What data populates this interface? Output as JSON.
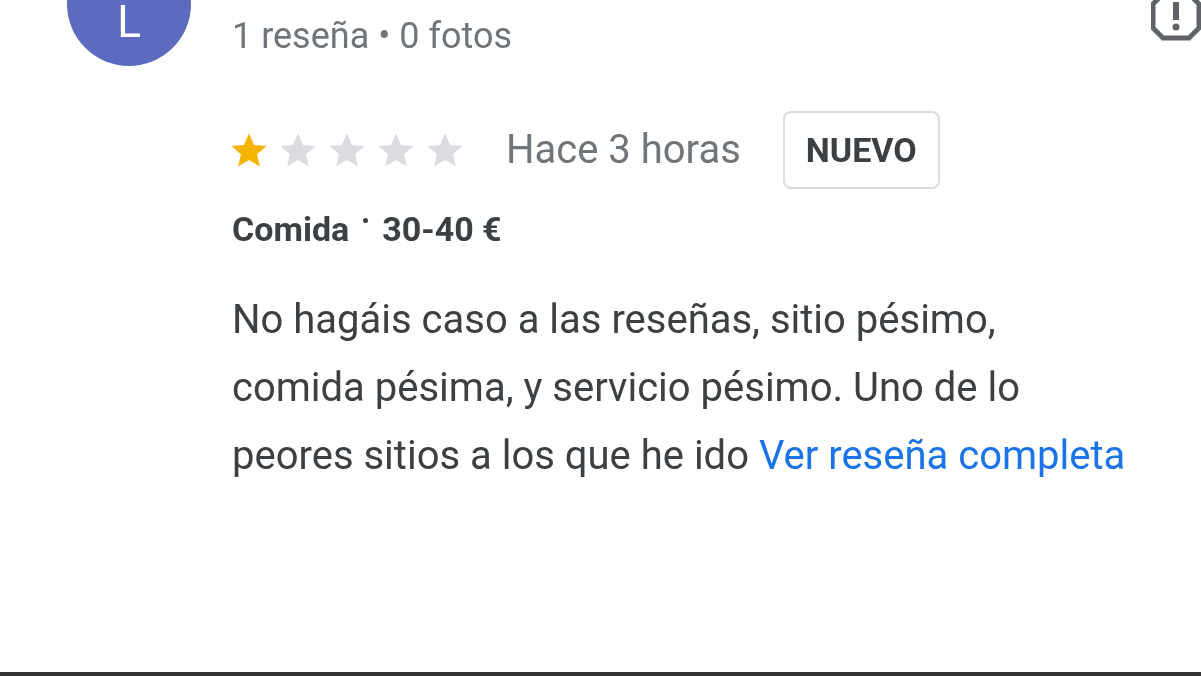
{
  "reviewer": {
    "avatar_letter": "L",
    "meta": "1 reseña • 0 fotos"
  },
  "review": {
    "stars": 1,
    "time": "Hace 3 horas",
    "badge": "NUEVO",
    "category": "Comida",
    "price": "30-40 €",
    "text_lines": [
      "No hagáis caso a las reseñas, sitio pésimo,",
      "comida pésima, y servicio pésimo. Uno de lo",
      "peores sitios a los que he ido"
    ],
    "link": "Ver reseña completa"
  }
}
